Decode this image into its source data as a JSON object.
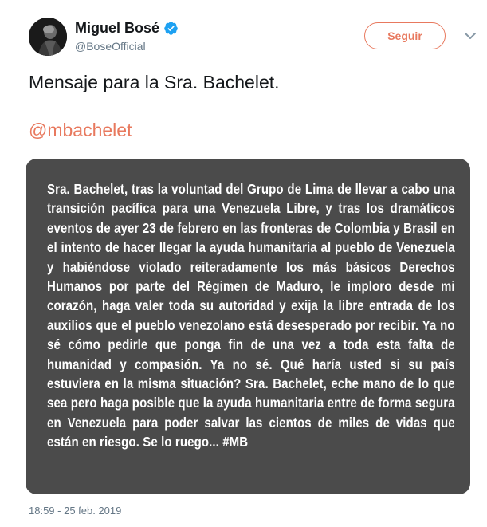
{
  "user": {
    "display_name": "Miguel Bosé",
    "handle": "@BoseOfficial",
    "verified": true
  },
  "actions": {
    "follow_label": "Seguir"
  },
  "tweet": {
    "text": "Mensaje para la Sra. Bachelet.",
    "mention": "@mbachelet",
    "image_text": "Sra. Bachelet, tras la voluntad del Grupo de Lima de llevar a cabo una transición pacífica para una Venezuela Libre, y tras los dramáticos eventos de ayer 23 de febrero en las fronteras de Colombia y Brasil en el intento de hacer llegar la ayuda humanitaria al pueblo de Venezuela y habiéndose violado reiteradamente los más básicos Derechos Humanos por parte del Régimen de Maduro, le imploro desde mi corazón, haga valer toda su autoridad y exija la libre entrada de los auxilios que el pueblo venezolano está desesperado por recibir. Ya no sé cómo pedirle que ponga fin de una vez a toda esta falta de humanidad y compasión. Ya no sé. Qué haría usted si su país estuviera en la misma situación? Sra. Bachelet, eche mano de lo que sea pero haga posible que la ayuda humanitaria entre de forma segura en Venezuela para poder salvar las cientos de miles de vidas que están en riesgo. Se lo ruego... #MB",
    "timestamp": "18:59 - 25 feb. 2019"
  },
  "colors": {
    "accent": "#e8795e",
    "verified": "#1da1f2",
    "image_bg": "#4b4b4b"
  },
  "icons": [
    "verified-badge-icon",
    "chevron-down-icon"
  ]
}
